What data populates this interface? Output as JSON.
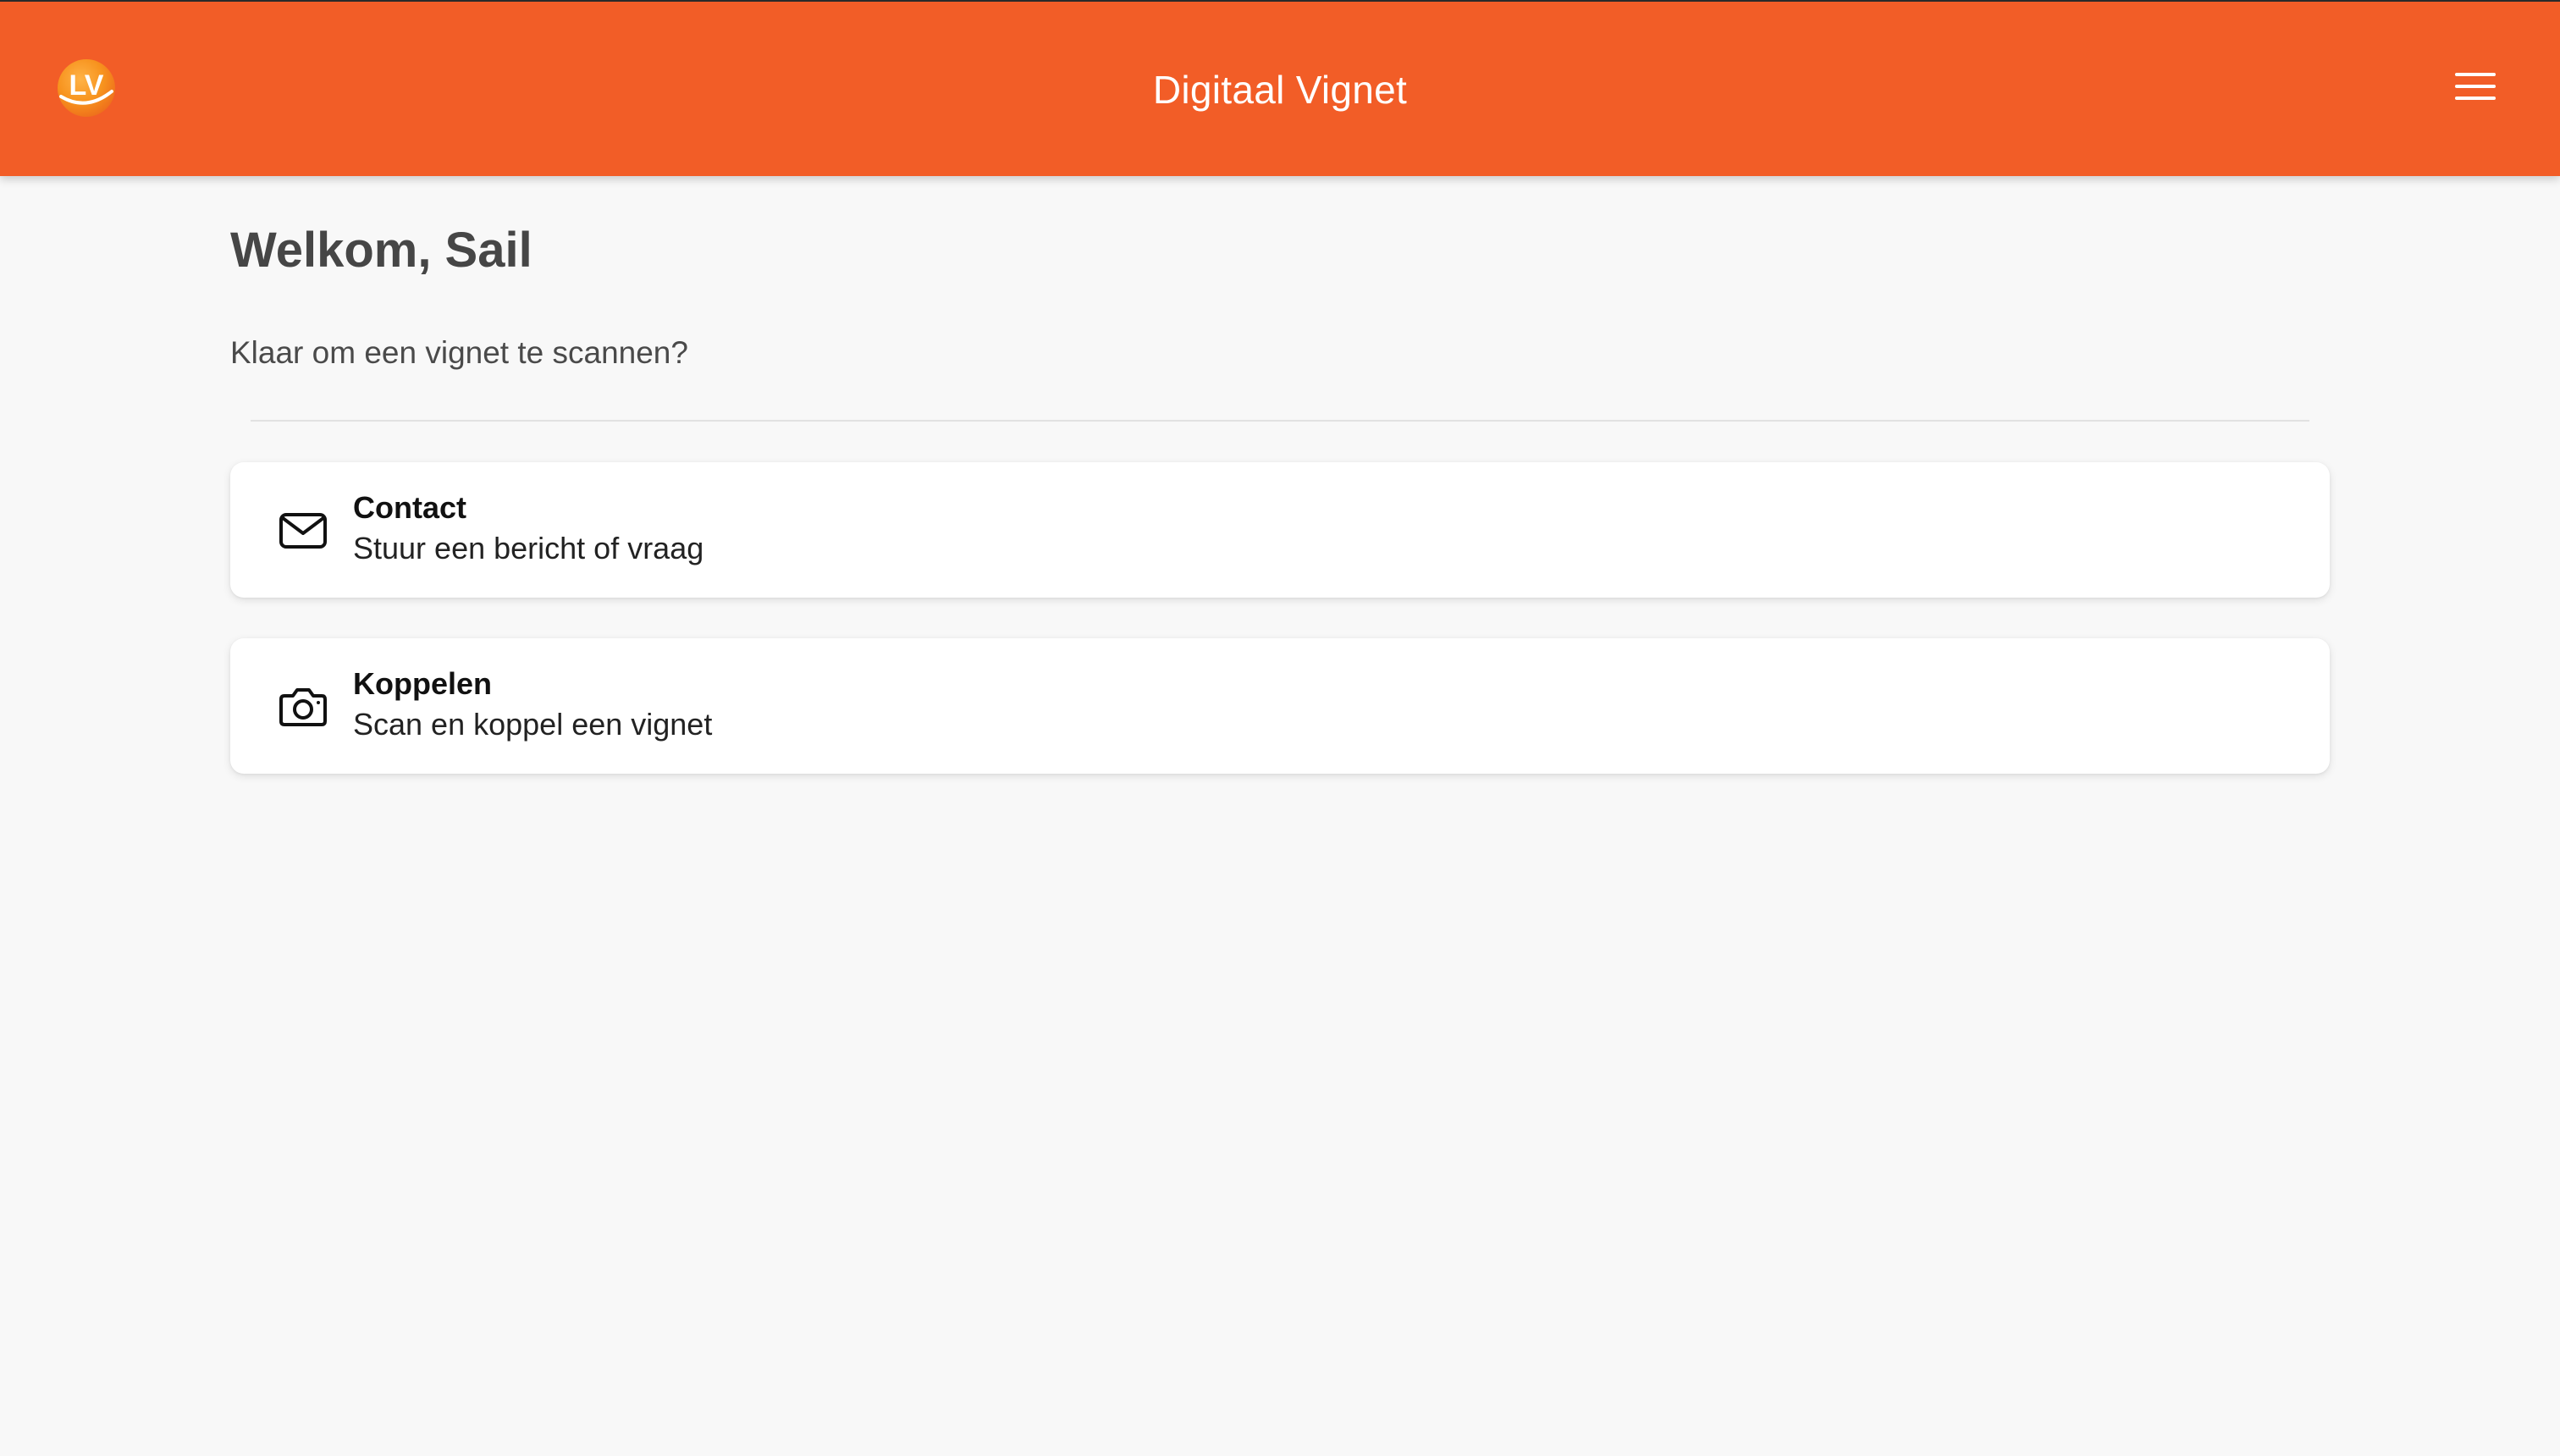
{
  "colors": {
    "header_bg": "#f25d27",
    "page_bg": "#f8f8f8",
    "card_bg": "#ffffff",
    "heading": "#464646",
    "text": "#222222"
  },
  "header": {
    "logo_text": "LV",
    "title": "Digitaal Vignet",
    "menu_icon": "hamburger-menu-icon"
  },
  "main": {
    "welcome": "Welkom, Sail",
    "subtitle": "Klaar om een vignet te scannen?",
    "cards": [
      {
        "icon": "envelope-icon",
        "title": "Contact",
        "description": "Stuur een bericht of vraag"
      },
      {
        "icon": "camera-icon",
        "title": "Koppelen",
        "description": "Scan en koppel een vignet"
      }
    ]
  }
}
